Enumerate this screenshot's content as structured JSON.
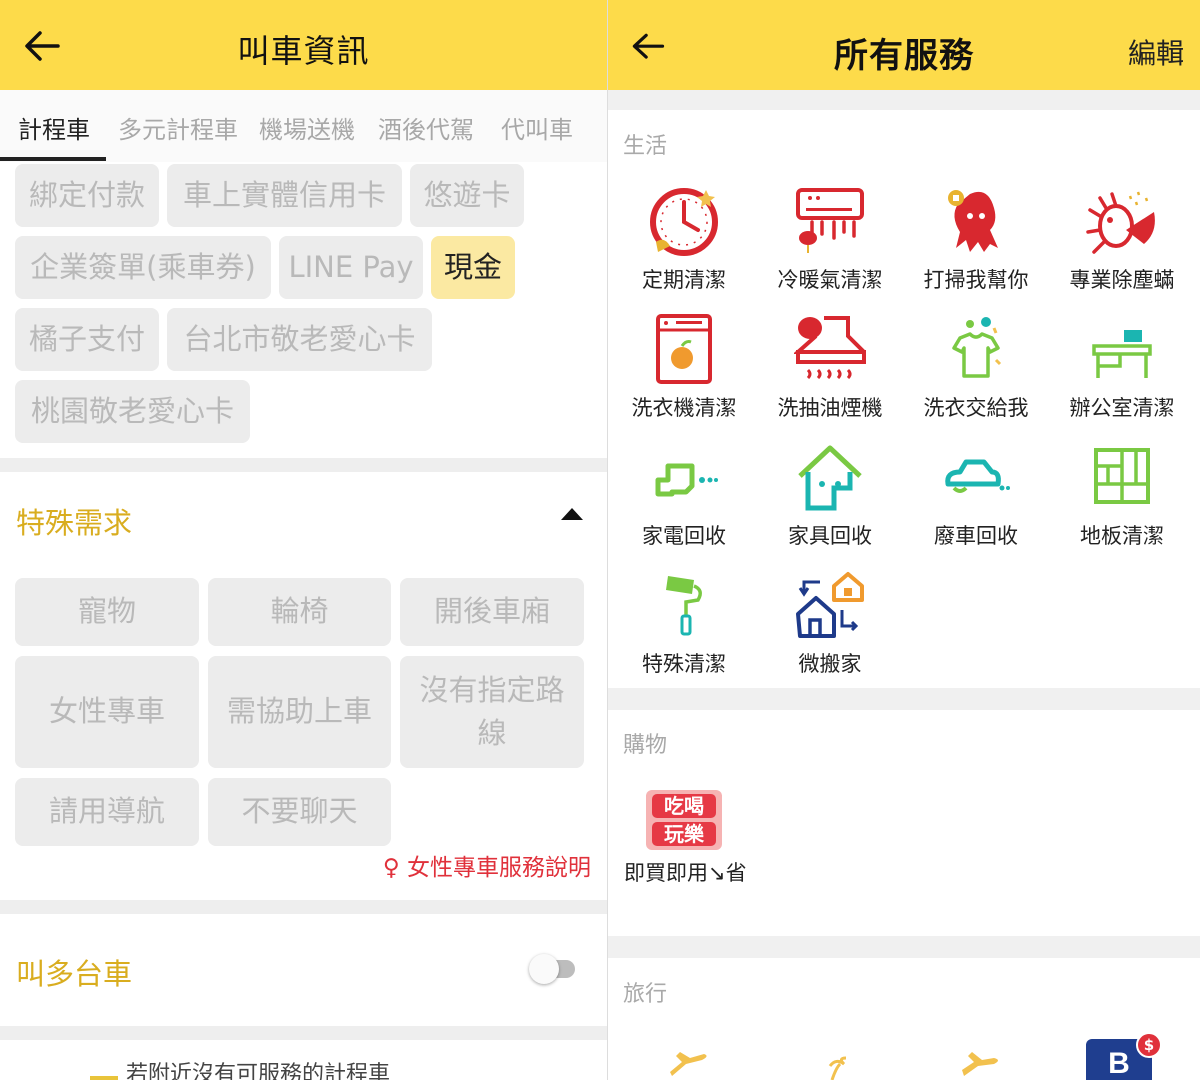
{
  "left": {
    "title": "叫車資訊",
    "tabs": [
      "計程車",
      "多元計程車",
      "機場送機",
      "酒後代駕",
      "代叫車"
    ],
    "payments": [
      "綁定付款",
      "車上實體信用卡",
      "悠遊卡",
      "企業簽單(乘車券)",
      "LINE Pay",
      "現金",
      "橘子支付",
      "台北市敬老愛心卡",
      "桃園敬老愛心卡"
    ],
    "selected_payment": "現金",
    "special_title": "特殊需求",
    "needs": [
      "寵物",
      "輪椅",
      "開後車廂",
      "女性專車",
      "需協助上車",
      "沒有指定路線",
      "請用導航",
      "不要聊天"
    ],
    "female_note": "♀ 女性專車服務說明",
    "multi_title": "叫多台車",
    "multi_enabled": false,
    "bottom_text": "若附近沒有可服務的計程車"
  },
  "right": {
    "title": "所有服務",
    "edit_label": "編輯",
    "life_label": "生活",
    "life": [
      "定期清潔",
      "冷暖氣清潔",
      "打掃我幫你",
      "專業除塵蟎",
      "洗衣機清潔",
      "洗抽油煙機",
      "洗衣交給我",
      "辦公室清潔",
      "家電回收",
      "家具回收",
      "廢車回收",
      "地板清潔",
      "特殊清潔",
      "微搬家"
    ],
    "shop_label": "購物",
    "shop_logo_top": "吃喝",
    "shop_logo_bottom": "玩樂",
    "shop_item": "即買即用↘省",
    "travel_label": "旅行",
    "travel_badge": "$",
    "travel_letter": "B"
  },
  "colors": {
    "header": "#fddb4a",
    "accent_text": "#d9ad1f",
    "selected_chip": "#fbe9a2",
    "alert": "#e0313b",
    "icon_red": "#d8282f",
    "icon_green": "#7ac943",
    "icon_teal": "#1bb5b1"
  }
}
